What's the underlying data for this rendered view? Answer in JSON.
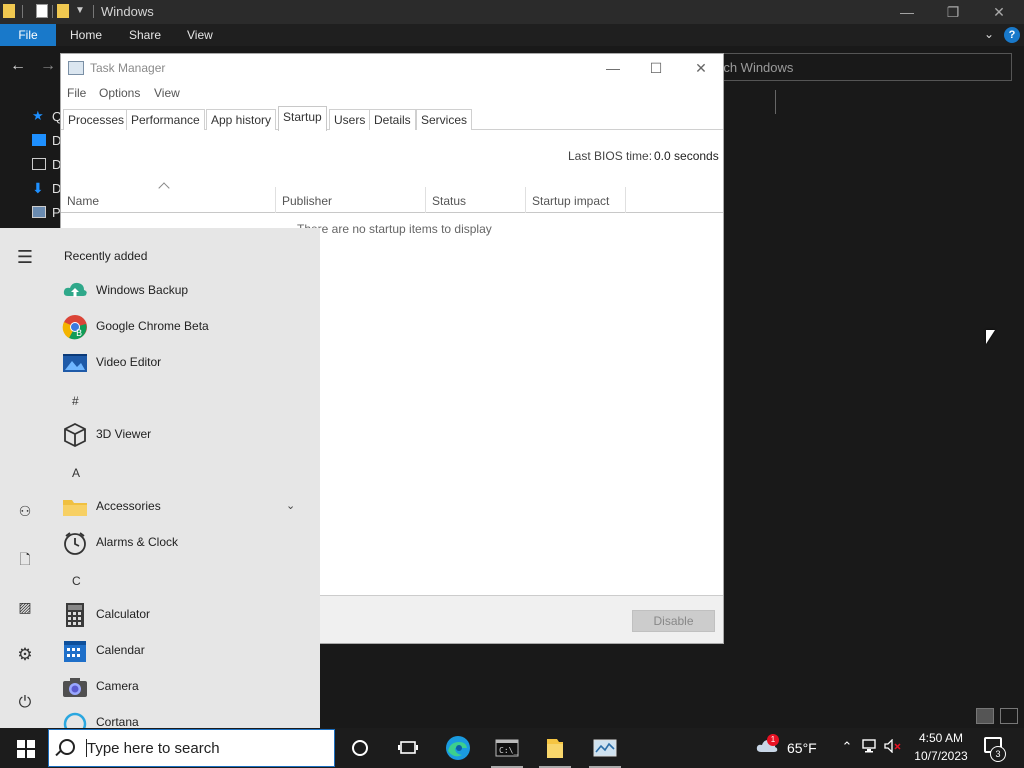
{
  "explorer": {
    "title": "Windows",
    "ribbon": {
      "file": "File",
      "home": "Home",
      "share": "Share",
      "view": "View"
    },
    "search_placeholder": "Search Windows",
    "search_visible": "rch Windows",
    "nav_labels": [
      "Qu",
      "D",
      "D",
      "D",
      "P"
    ],
    "caption": {
      "min": "—",
      "max": "❐",
      "close": "✕"
    }
  },
  "task_manager": {
    "title": "Task Manager",
    "menu": [
      "File",
      "Options",
      "View"
    ],
    "tabs": [
      "Processes",
      "Performance",
      "App history",
      "Startup",
      "Users",
      "Details",
      "Services"
    ],
    "active_tab": "Startup",
    "bios_label": "Last BIOS time:",
    "bios_value": "0.0 seconds",
    "columns": [
      "Name",
      "Publisher",
      "Status",
      "Startup impact"
    ],
    "empty_message": "There are no startup items to display",
    "disable_button": "Disable",
    "caption": {
      "min": "—",
      "max": "☐",
      "close": "✕"
    }
  },
  "start_menu": {
    "recent_title": "Recently added",
    "apps": [
      {
        "label": "Windows Backup",
        "icon": "cloud-backup-icon",
        "color": "#2fa88a"
      },
      {
        "label": "Google Chrome Beta",
        "icon": "chrome-beta-icon",
        "color": "#3b7ae0"
      },
      {
        "label": "Video Editor",
        "icon": "video-editor-icon",
        "color": "#1e5aa8"
      }
    ],
    "letters": [
      "#",
      "A",
      "C"
    ],
    "apps_hash": [
      {
        "label": "3D Viewer",
        "icon": "cube-icon"
      }
    ],
    "apps_a": [
      {
        "label": "Accessories",
        "icon": "folder-icon",
        "color": "#f0c040"
      },
      {
        "label": "Alarms & Clock",
        "icon": "clock-icon"
      }
    ],
    "apps_c": [
      {
        "label": "Calculator",
        "icon": "calculator-icon",
        "color": "#3a3a3a"
      },
      {
        "label": "Calendar",
        "icon": "calendar-icon",
        "color": "#1e6fc9"
      },
      {
        "label": "Camera",
        "icon": "camera-icon",
        "color": "#505050"
      },
      {
        "label": "Cortana",
        "icon": "cortana-icon",
        "color": "#2aa7e0"
      }
    ]
  },
  "taskbar": {
    "search_placeholder": "Type here to search",
    "weather_temp": "65°F",
    "weather_alert": "1",
    "time": "4:50 AM",
    "date": "10/7/2023",
    "notification_count": "3"
  }
}
